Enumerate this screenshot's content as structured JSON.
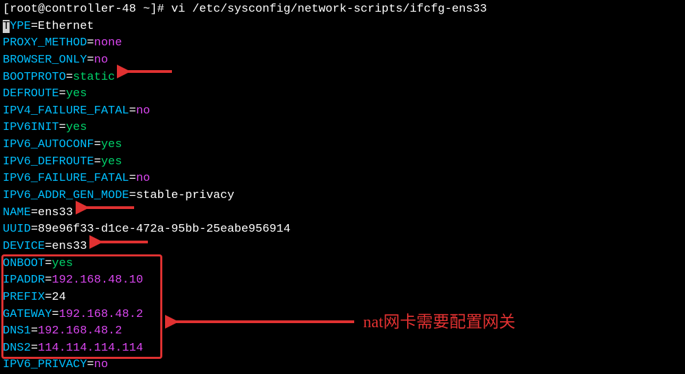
{
  "prompt": {
    "open": "[",
    "user": "root@controller-48",
    "path": " ~",
    "close": "]# ",
    "cmd": "vi /etc/sysconfig/network-scripts/ifcfg-ens33"
  },
  "lines": [
    {
      "key_cursor": "T",
      "key_rest": "YPE",
      "val": "Ethernet",
      "cls": "val-white"
    },
    {
      "key": "PROXY_METHOD",
      "val": "none",
      "cls": "val-magenta"
    },
    {
      "key": "BROWSER_ONLY",
      "val": "no",
      "cls": "val-magenta"
    },
    {
      "key": "BOOTPROTO",
      "val": "static",
      "cls": "val-green"
    },
    {
      "key": "DEFROUTE",
      "val": "yes",
      "cls": "val-green"
    },
    {
      "key": "IPV4_FAILURE_FATAL",
      "val": "no",
      "cls": "val-magenta"
    },
    {
      "key": "IPV6INIT",
      "val": "yes",
      "cls": "val-green"
    },
    {
      "key": "IPV6_AUTOCONF",
      "val": "yes",
      "cls": "val-green"
    },
    {
      "key": "IPV6_DEFROUTE",
      "val": "yes",
      "cls": "val-green"
    },
    {
      "key": "IPV6_FAILURE_FATAL",
      "val": "no",
      "cls": "val-magenta"
    },
    {
      "key": "IPV6_ADDR_GEN_MODE",
      "val": "stable-privacy",
      "cls": "val-white"
    },
    {
      "key": "NAME",
      "val": "ens33",
      "cls": "val-white"
    },
    {
      "key": "UUID",
      "val": "89e96f33-d1ce-472a-95bb-25eabe956914",
      "cls": "val-white"
    },
    {
      "key": "DEVICE",
      "val": "ens33",
      "cls": "val-white"
    },
    {
      "key": "ONBOOT",
      "val": "yes",
      "cls": "val-green"
    },
    {
      "key": "IPADDR",
      "val": "192.168.48.10",
      "cls": "val-magenta"
    },
    {
      "key": "PREFIX",
      "val": "24",
      "cls": "val-white"
    },
    {
      "key": "GATEWAY",
      "val": "192.168.48.2",
      "cls": "val-magenta"
    },
    {
      "key": "DNS1",
      "val": "192.168.48.2",
      "cls": "val-magenta"
    },
    {
      "key": "DNS2",
      "val": "114.114.114.114",
      "cls": "val-magenta"
    },
    {
      "key": "IPV6_PRIVACY",
      "val": "no",
      "cls": "val-magenta"
    }
  ],
  "annotation": "nat网卡需要配置网关"
}
